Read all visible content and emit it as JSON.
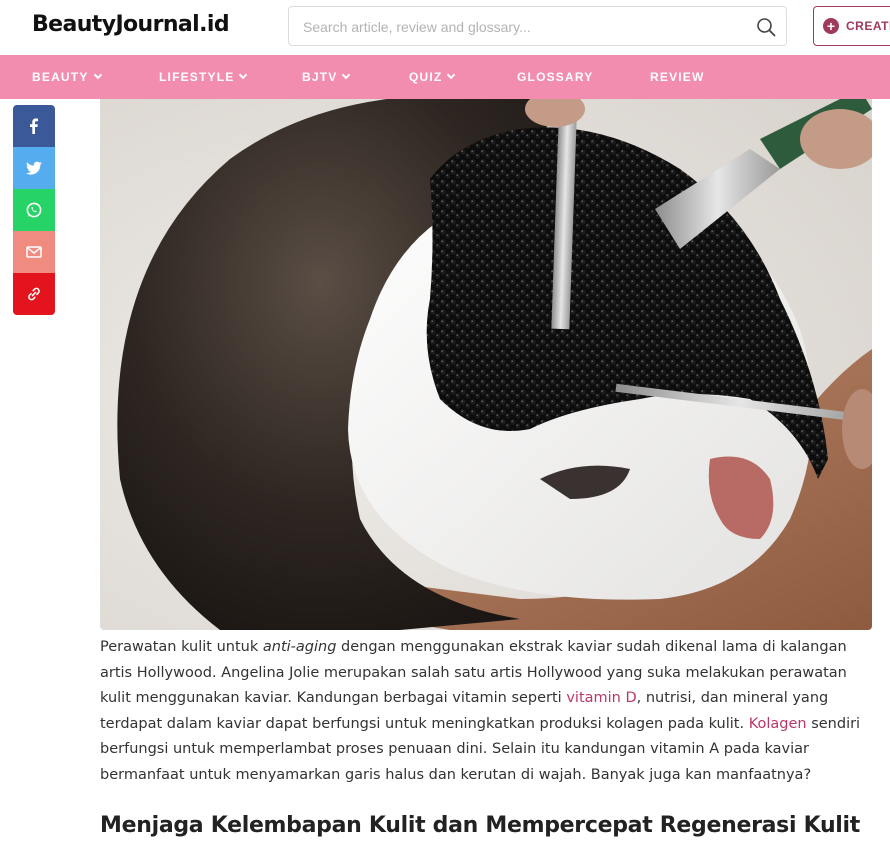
{
  "header": {
    "logo": "BeautyJournal.id",
    "search_placeholder": "Search article, review and glossary...",
    "create_label": "CREATE"
  },
  "nav": {
    "items": [
      {
        "label": "BEAUTY",
        "has_dropdown": true
      },
      {
        "label": "LIFESTYLE",
        "has_dropdown": true
      },
      {
        "label": "BJTV",
        "has_dropdown": true
      },
      {
        "label": "QUIZ",
        "has_dropdown": true
      },
      {
        "label": "GLOSSARY",
        "has_dropdown": false
      },
      {
        "label": "REVIEW",
        "has_dropdown": false
      }
    ],
    "bg_color": "#f28db0"
  },
  "share": [
    {
      "name": "facebook-icon",
      "color": "#3b5998"
    },
    {
      "name": "twitter-icon",
      "color": "#55acee"
    },
    {
      "name": "whatsapp-icon",
      "color": "#25d366"
    },
    {
      "name": "email-icon",
      "color": "#f08b80"
    },
    {
      "name": "link-icon",
      "color": "#e3141e"
    }
  ],
  "article": {
    "p_text_1": "Perawatan kulit untuk ",
    "p_em_1": "anti-aging",
    "p_text_2": " dengan menggunakan ekstrak kaviar sudah dikenal lama di kalangan artis Hollywood. Angelina Jolie merupakan salah satu artis Hollywood yang suka melakukan perawatan kulit menggunakan kaviar. Kandungan berbagai vitamin seperti ",
    "p_link_1": "vitamin D",
    "p_text_3": ", nutrisi, dan mineral yang terdapat dalam kaviar dapat berfungsi untuk meningkatkan produksi kolagen pada kulit. ",
    "p_link_2": "Kolagen",
    "p_text_4": " sendiri berfungsi untuk memperlambat proses penuaan dini. Selain itu kandungan vitamin A pada kaviar bermanfaat untuk menyamarkan garis halus dan kerutan di wajah. Banyak juga kan manfaatnya?",
    "heading": "Menjaga Kelembapan Kulit dan Mempercepat Regenerasi Kulit",
    "link_color": "#b9376a"
  }
}
